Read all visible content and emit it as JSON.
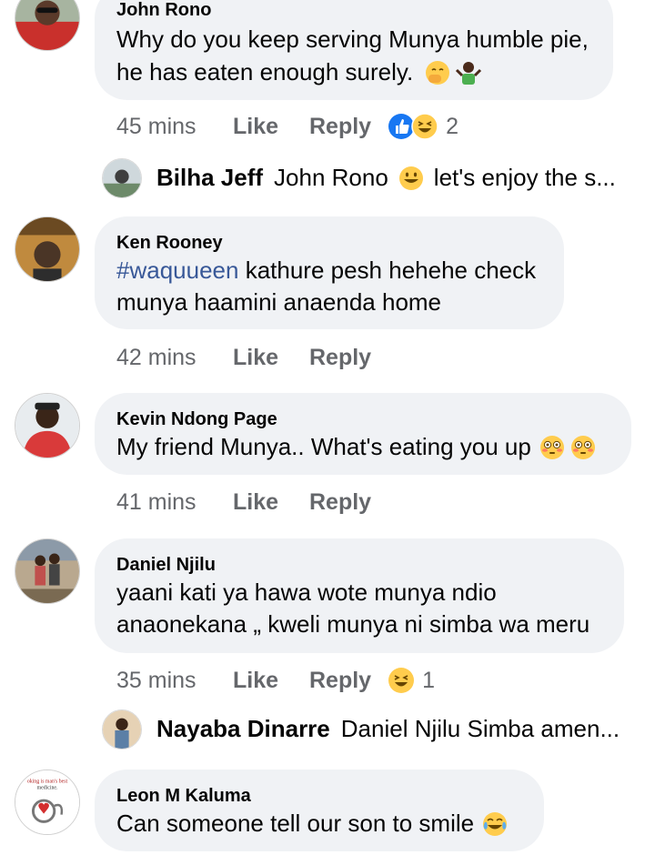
{
  "comments": [
    {
      "name": "John Rono",
      "lines": [
        "Why do you keep serving Munya humble pie,",
        "he has eaten enough surely."
      ],
      "time": "45 mins",
      "like": "Like",
      "reply": "Reply",
      "reaction_count": "2",
      "reaction_icons": [
        "like-reaction-icon",
        "haha-reaction-icon"
      ],
      "inline_emojis": [
        "hand-over-mouth-emoji",
        "person-shrugging-emoji"
      ],
      "reply_preview": {
        "name": "Bilha Jeff",
        "text_before": "John Rono",
        "text_after": "let's enjoy the s...",
        "emoji": "grinning-face-emoji"
      }
    },
    {
      "name": "Ken Rooney",
      "hashtag": "#waquueen",
      "line1_rest": " kathure pesh hehehe check",
      "line2": "munya haamini anaenda home",
      "time": "42 mins",
      "like": "Like",
      "reply": "Reply"
    },
    {
      "name": "Kevin Ndong Page",
      "line1": "My friend Munya.. What's eating you up",
      "inline_emojis": [
        "flushed-face-emoji",
        "flushed-face-emoji"
      ],
      "time": "41 mins",
      "like": "Like",
      "reply": "Reply"
    },
    {
      "name": "Daniel Njilu",
      "lines": [
        "yaani kati ya hawa wote munya ndio",
        "anaonekana „ kweli munya ni simba wa meru"
      ],
      "time": "35 mins",
      "like": "Like",
      "reply": "Reply",
      "reaction_count": "1",
      "reaction_icons": [
        "haha-reaction-icon"
      ],
      "reply_preview": {
        "name": "Nayaba Dinarre",
        "text": "Daniel Njilu Simba amen..."
      }
    },
    {
      "name": "Leon M Kaluma",
      "line1": "Can someone tell our son to smile",
      "inline_emojis": [
        "tears-of-joy-emoji"
      ],
      "avatar_text": [
        "oking is man's best",
        "medicine."
      ]
    }
  ],
  "colors": {
    "bubble": "#f0f2f5",
    "meta_text": "#65676b",
    "hashtag": "#385898",
    "like_blue": "#1877f2",
    "emoji_yellow": "#ffcc4d"
  }
}
